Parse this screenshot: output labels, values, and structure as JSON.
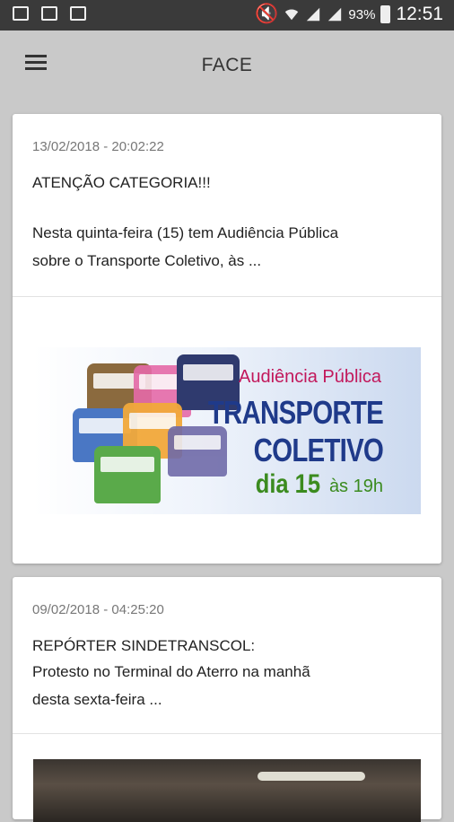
{
  "status_bar": {
    "battery_percent": "93%",
    "time": "12:51"
  },
  "app_bar": {
    "title": "FACE"
  },
  "posts": [
    {
      "date": "13/02/2018 - 20:02:22",
      "headline": "ATENÇÃO CATEGORIA!!!",
      "excerpt_line1": "Nesta quinta-feira (15) tem Audiência Pública",
      "excerpt_line2": "sobre o Transporte Coletivo, às ...",
      "banner": {
        "subtitle": "Audiência Pública",
        "title_line1": "TRANSPORTE",
        "title_line2": "COLETIVO",
        "day": "dia 15",
        "hour": "às 19h"
      }
    },
    {
      "date": "09/02/2018 - 04:25:20",
      "headline": "REPÓRTER SINDETRANSCOL:",
      "excerpt_line1": "Protesto no Terminal do Aterro na manhã",
      "excerpt_line2": "desta sexta-feira ..."
    }
  ]
}
